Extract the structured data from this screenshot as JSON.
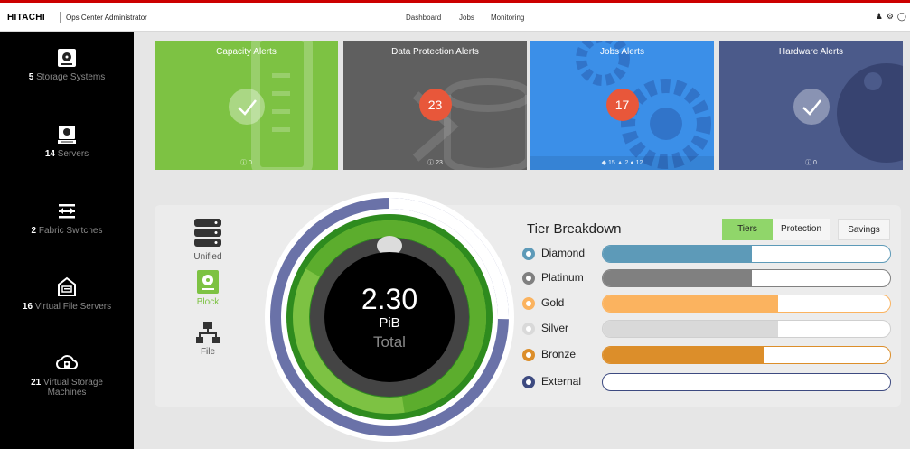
{
  "header": {
    "brand": "HITACHI",
    "app_name": "Ops Center Administrator",
    "nav": [
      "Dashboard",
      "Jobs",
      "Monitoring"
    ]
  },
  "sidebar": {
    "items": [
      {
        "count": "5",
        "label": "Storage Systems",
        "icon": "storage-system-icon"
      },
      {
        "count": "14",
        "label": "Servers",
        "icon": "server-icon"
      },
      {
        "count": "2",
        "label": "Fabric Switches",
        "icon": "switch-icon"
      },
      {
        "count": "16",
        "label": "Virtual File Servers",
        "icon": "virtual-file-server-icon"
      },
      {
        "count": "21",
        "label": "Virtual Storage",
        "label2": "Machines",
        "icon": "virtual-storage-machine-icon"
      }
    ]
  },
  "alerts": [
    {
      "title": "Capacity Alerts",
      "count": null,
      "footer": "0",
      "color": "#7dc243",
      "status": "ok"
    },
    {
      "title": "Data Protection Alerts",
      "count": "23",
      "footer": "23",
      "color": "#5f5f5f",
      "status": "alert"
    },
    {
      "title": "Jobs Alerts",
      "count": "17",
      "footer": "15 ▲ 2 ● 12",
      "color": "#3b8fe8",
      "status": "alert"
    },
    {
      "title": "Hardware Alerts",
      "count": null,
      "footer": "0",
      "color": "#4b5a8a",
      "status": "ok"
    }
  ],
  "storage_types": [
    {
      "label": "Unified",
      "active": false,
      "icon": "unified-icon"
    },
    {
      "label": "Block",
      "active": true,
      "icon": "block-icon"
    },
    {
      "label": "File",
      "active": false,
      "icon": "file-icon"
    }
  ],
  "capacity": {
    "value": "2.30",
    "unit": "PiB",
    "label": "Total"
  },
  "tier_breakdown": {
    "title": "Tier Breakdown",
    "buttons": [
      {
        "label": "Tiers",
        "active": true
      },
      {
        "label": "Protection",
        "active": false
      },
      {
        "label": "Savings",
        "active": false
      }
    ],
    "tiers": [
      {
        "name": "Diamond",
        "color": "#5d9ab8",
        "fill": 0.52
      },
      {
        "name": "Platinum",
        "color": "#808080",
        "fill": 0.52
      },
      {
        "name": "Gold",
        "color": "#fbb35f",
        "fill": 0.61
      },
      {
        "name": "Silver",
        "color": "#d9d9d9",
        "fill": 0.61
      },
      {
        "name": "Bronze",
        "color": "#dc8e2a",
        "fill": 0.56
      },
      {
        "name": "External",
        "color": "#3d4a80",
        "fill": 0.0
      }
    ]
  }
}
